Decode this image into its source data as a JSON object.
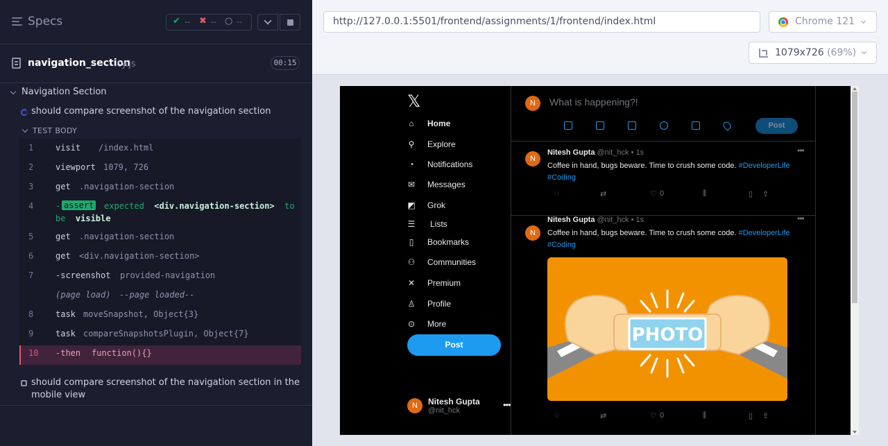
{
  "runner": {
    "specs_label": "Specs",
    "stats": {
      "passed": "--",
      "failed": "--",
      "pending": "--"
    },
    "spec": {
      "name": "navigation_section",
      "ext": ".cy.js",
      "duration": "00:15"
    },
    "suite_title": "Navigation Section",
    "test1_title": "should compare screenshot of the navigation section",
    "test_body_label": "TEST BODY",
    "commands": [
      {
        "num": "1",
        "name": "visit",
        "message": "/index.html"
      },
      {
        "num": "2",
        "name": "viewport",
        "message": "1079, 726"
      },
      {
        "num": "3",
        "name": "get",
        "message": ".navigation-section"
      },
      {
        "num": "4",
        "name": "-",
        "badge": "assert",
        "part1": "expected",
        "subject": "<div.navigation-section>",
        "part2": "to",
        "part3": "be",
        "result": "visible"
      },
      {
        "num": "5",
        "name": "get",
        "message": ".navigation-section"
      },
      {
        "num": "6",
        "name": "get",
        "message": "<div.navigation-section>"
      },
      {
        "num": "7",
        "name": "-screenshot",
        "message": "provided-navigation"
      },
      {
        "num": "",
        "name": "(page load)",
        "message": "--page loaded--"
      },
      {
        "num": "8",
        "name": "task",
        "message": "moveSnapshot, Object{3}"
      },
      {
        "num": "9",
        "name": "task",
        "message": "compareSnapshotsPlugin, Object{7}"
      },
      {
        "num": "10",
        "name": "-then",
        "message": "function(){}"
      }
    ],
    "test2_title": "should compare screenshot of the navigation section in the mobile view"
  },
  "aut": {
    "url": "http://127.0.0.1:5501/frontend/assignments/1/frontend/index.html",
    "browser": "Chrome 121",
    "viewport": "1079x726",
    "viewport_pct": "(69%)"
  },
  "app": {
    "logo": "𝕏",
    "nav_items": [
      {
        "label": "Home",
        "icon": "home-icon"
      },
      {
        "label": "Explore",
        "icon": "search-icon"
      },
      {
        "label": "Notifications",
        "icon": "bell-icon"
      },
      {
        "label": "Messages",
        "icon": "envelope-icon"
      },
      {
        "label": "Grok",
        "icon": "grok-icon"
      },
      {
        "label": "Lists",
        "icon": "list-icon"
      },
      {
        "label": "Bookmarks",
        "icon": "bookmark-icon"
      },
      {
        "label": "Communities",
        "icon": "people-icon"
      },
      {
        "label": "Premium",
        "icon": "x-icon"
      },
      {
        "label": "Profile",
        "icon": "user-icon"
      },
      {
        "label": "More",
        "icon": "more-circle-icon"
      }
    ],
    "post_button": "Post",
    "user": {
      "initial": "N",
      "name": "Nitesh Gupta",
      "handle": "@nit_hck"
    },
    "compose": {
      "placeholder": "What is happening?!",
      "post_button": "Post"
    },
    "tweets": [
      {
        "initial": "N",
        "name": "Nitesh Gupta",
        "meta": "@nit_hck • 1s",
        "text": "Coffee in hand, bugs beware. Time to crush some code. ",
        "tag1": "#DeveloperLife",
        "tag2": "#Coding",
        "likes": "0"
      },
      {
        "initial": "N",
        "name": "Nitesh Gupta",
        "meta": "@nit_hck • 1s",
        "text": "Coffee in hand, bugs beware. Time to crush some code. ",
        "tag1": "#DeveloperLife",
        "tag2": "#Coding",
        "photo_label": "PHOTO",
        "likes": "0"
      }
    ]
  }
}
